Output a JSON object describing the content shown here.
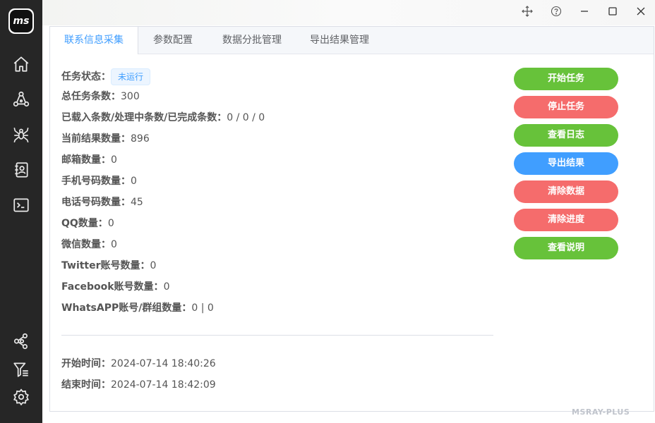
{
  "app": {
    "logo_text": "ms",
    "watermark": "MSRAY-PLUS"
  },
  "window_controls": [
    "move-icon",
    "help-icon",
    "minimize-icon",
    "maximize-icon",
    "close-icon"
  ],
  "sidebar": {
    "top_items": [
      "home-icon",
      "network-icon",
      "spider-icon",
      "contacts-icon",
      "terminal-icon"
    ],
    "bottom_items": [
      "share-icon",
      "filter-icon",
      "settings-icon"
    ]
  },
  "tabs": [
    {
      "label": "联系信息采集",
      "active": true
    },
    {
      "label": "参数配置",
      "active": false
    },
    {
      "label": "数据分批管理",
      "active": false
    },
    {
      "label": "导出结果管理",
      "active": false
    }
  ],
  "task": {
    "status_label": "任务状态：",
    "status_value": "未运行",
    "lines": [
      {
        "label": "总任务条数：",
        "value": "300"
      },
      {
        "label": "已载入条数/处理中条数/已完成条数：",
        "value": "0 / 0 / 0"
      },
      {
        "label": "当前结果数量：",
        "value": "896"
      },
      {
        "label": "邮箱数量：",
        "value": "0"
      },
      {
        "label": "手机号码数量：",
        "value": "0"
      },
      {
        "label": "电话号码数量：",
        "value": "45"
      },
      {
        "label": "QQ数量：",
        "value": "0"
      },
      {
        "label": "微信数量：",
        "value": "0"
      },
      {
        "label": "Twitter账号数量：",
        "value": "0"
      },
      {
        "label": "Facebook账号数量：",
        "value": "0"
      },
      {
        "label": "WhatsAPP账号/群组数量：",
        "value": "0 | 0"
      }
    ],
    "start_time_label": "开始时间：",
    "start_time": "2024-07-14 18:40:26",
    "end_time_label": "结束时间：",
    "end_time": "2024-07-14 18:42:09"
  },
  "actions": [
    {
      "label": "开始任务",
      "color": "#67c23a"
    },
    {
      "label": "停止任务",
      "color": "#f56c6c"
    },
    {
      "label": "查看日志",
      "color": "#67c23a"
    },
    {
      "label": "导出结果",
      "color": "#409eff"
    },
    {
      "label": "清除数据",
      "color": "#f56c6c"
    },
    {
      "label": "清除进度",
      "color": "#f56c6c"
    },
    {
      "label": "查看说明",
      "color": "#67c23a"
    }
  ]
}
